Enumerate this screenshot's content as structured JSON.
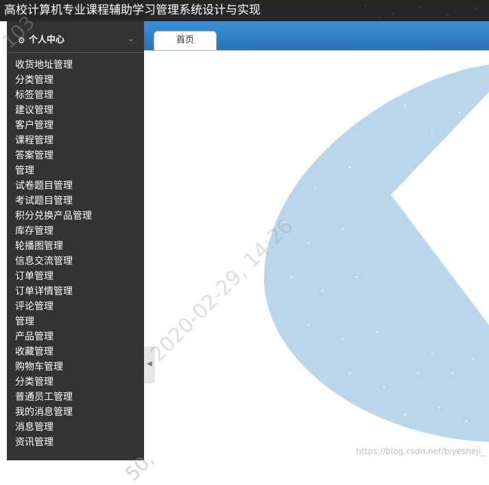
{
  "app": {
    "title": "高校计算机专业课程辅助学习管理系统设计与实现"
  },
  "sidebar": {
    "header": {
      "label": "个人中心",
      "icon": "gears-icon",
      "chevron": "chevron-down-icon"
    },
    "items": [
      {
        "label": "收货地址管理"
      },
      {
        "label": "分类管理"
      },
      {
        "label": "标签管理"
      },
      {
        "label": "建议管理"
      },
      {
        "label": "客户管理"
      },
      {
        "label": "课程管理"
      },
      {
        "label": "答案管理"
      },
      {
        "label": "管理"
      },
      {
        "label": "试卷题目管理"
      },
      {
        "label": "考试题目管理"
      },
      {
        "label": "积分兑换产品管理"
      },
      {
        "label": "库存管理"
      },
      {
        "label": "轮播图管理"
      },
      {
        "label": "信息交流管理"
      },
      {
        "label": "订单管理"
      },
      {
        "label": "订单详情管理"
      },
      {
        "label": "评论管理"
      },
      {
        "label": "管理"
      },
      {
        "label": "产品管理"
      },
      {
        "label": "收藏管理"
      },
      {
        "label": "购物车管理"
      },
      {
        "label": "分类管理"
      },
      {
        "label": "普通员工管理"
      },
      {
        "label": "我的消息管理"
      },
      {
        "label": "消息管理"
      },
      {
        "label": "资讯管理"
      }
    ]
  },
  "tabs": [
    {
      "label": "首页",
      "active": true
    }
  ],
  "watermarks": {
    "url": "https://blog.csdn.net/biyesheji_",
    "diagonal": "2020-02-29, 14:26",
    "corner": "103",
    "bottom": "50,"
  },
  "colors": {
    "topbar_bg": "#262626",
    "sidebar_bg": "#333333",
    "tabbar_blue": "#2b72b4",
    "decor_blue": "#bad6ea"
  }
}
